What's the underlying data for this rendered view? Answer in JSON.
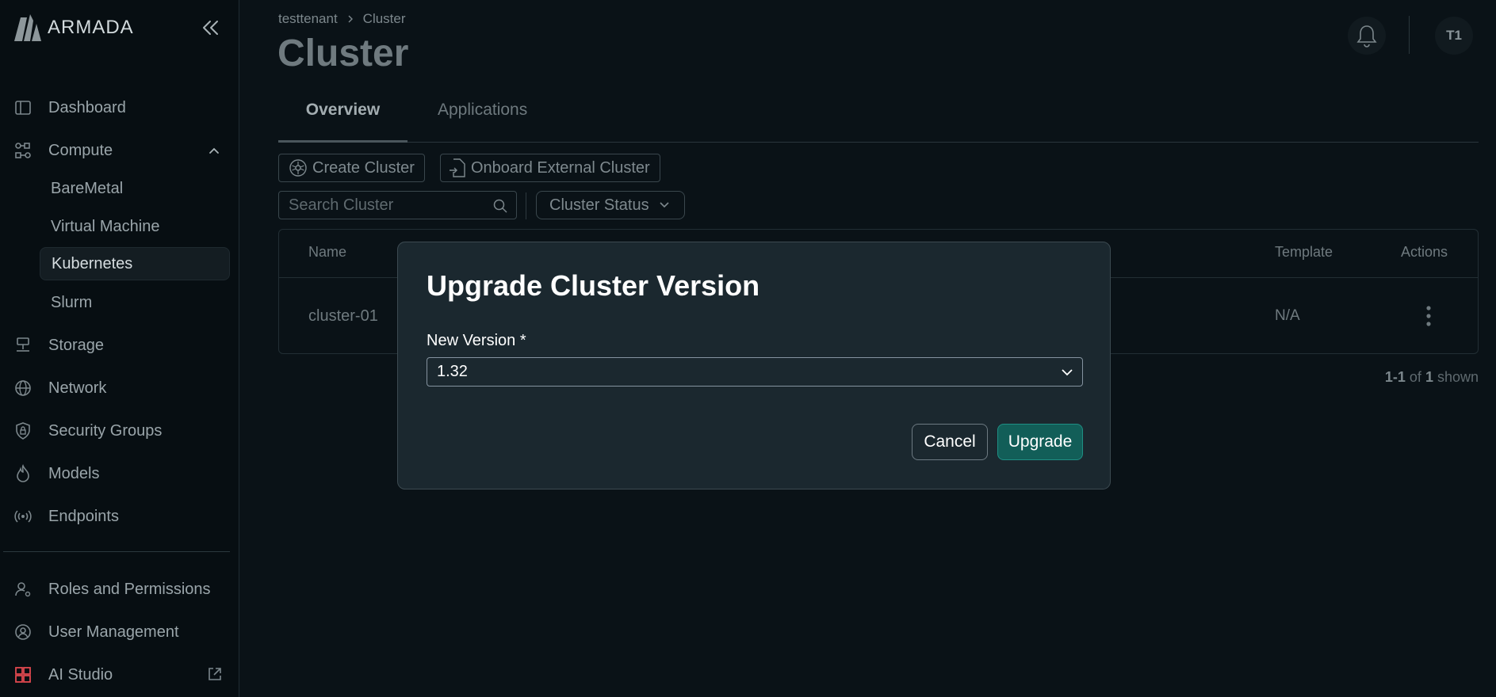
{
  "brand": {
    "name": "ARMADA"
  },
  "sidebar": {
    "items": [
      {
        "label": "Dashboard",
        "icon": "sidebar-panel-icon"
      },
      {
        "label": "Compute",
        "icon": "compute-nodes-icon"
      },
      {
        "label": "Storage",
        "icon": "storage-icon"
      },
      {
        "label": "Network",
        "icon": "globe-icon"
      },
      {
        "label": "Security Groups",
        "icon": "shield-lock-icon"
      },
      {
        "label": "Models",
        "icon": "flame-icon"
      },
      {
        "label": "Endpoints",
        "icon": "broadcast-icon"
      },
      {
        "label": "Roles and Permissions",
        "icon": "users-gear-icon"
      },
      {
        "label": "User Management",
        "icon": "user-circle-icon"
      },
      {
        "label": "AI Studio",
        "icon": "grid-apps-icon"
      }
    ],
    "compute_children": [
      "BareMetal",
      "Virtual Machine",
      "Kubernetes",
      "Slurm"
    ],
    "active": "Kubernetes"
  },
  "header": {
    "breadcrumb": [
      "testtenant",
      "Cluster"
    ],
    "title": "Cluster",
    "avatar": "T1"
  },
  "tabs": [
    {
      "label": "Overview",
      "active": true
    },
    {
      "label": "Applications",
      "active": false
    }
  ],
  "toolbar": {
    "create_label": "Create Cluster",
    "onboard_label": "Onboard External Cluster",
    "search_placeholder": "Search Cluster",
    "status_filter": "Cluster Status"
  },
  "table": {
    "columns": [
      "Name",
      "Template",
      "Actions"
    ],
    "rows": [
      {
        "name": "cluster-01",
        "template": "N/A"
      }
    ],
    "pager": {
      "range": "1-1",
      "of": "of",
      "total": "1",
      "suffix": "shown"
    }
  },
  "modal": {
    "title": "Upgrade Cluster Version",
    "field_label": "New Version *",
    "selected_version": "1.32",
    "cancel_label": "Cancel",
    "upgrade_label": "Upgrade"
  },
  "colors": {
    "background": "#0a1217",
    "modal_bg": "#1b282f",
    "primary_button": "#125e58",
    "ai_studio_icon": "#e0484f"
  }
}
